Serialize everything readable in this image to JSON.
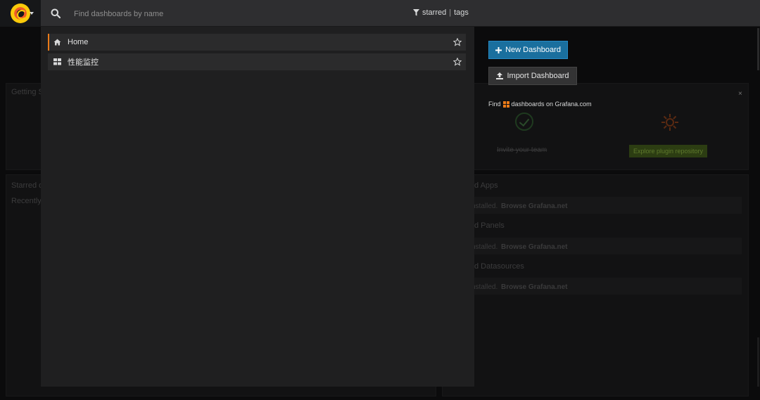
{
  "topbar": {
    "search_placeholder": "Find dashboards by name",
    "filter_starred": "starred",
    "filter_sep": "|",
    "filter_tags": "tags"
  },
  "results": [
    {
      "label": "Home",
      "icon": "home-icon",
      "selected": true
    },
    {
      "label": "性能监控",
      "icon": "dashboard-grid-icon",
      "selected": false
    }
  ],
  "actions": {
    "new_dashboard": "New Dashboard",
    "import_dashboard": "Import Dashboard",
    "find_prefix": "Find",
    "find_suffix": "dashboards on Grafana.com"
  },
  "background": {
    "getting_started": "Getting S",
    "starred": "Starred d",
    "recently": "Recently",
    "invite_team": "Invite your team",
    "explore_plugins": "Explore plugin repository",
    "apps_title": "d Apps",
    "panels_title": "d Panels",
    "datasources_title": "d Datasources",
    "installed_text": "nstalled.",
    "browse_link": "Browse Grafana.net",
    "close": "×"
  },
  "colors": {
    "accent_orange": "#eb7b18",
    "primary_blue": "#1a6f9e",
    "topbar_bg": "#2e2e30",
    "dropdown_bg": "#1f1f20"
  }
}
